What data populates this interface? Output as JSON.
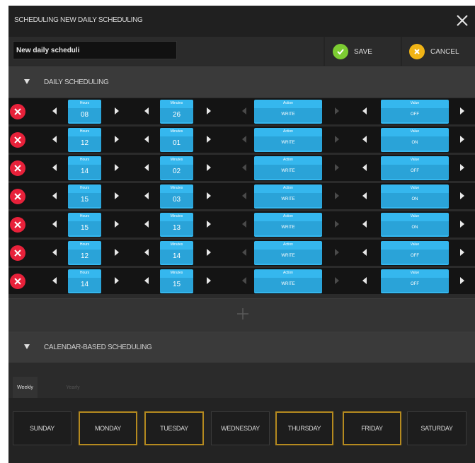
{
  "window": {
    "title": "SCHEDULING NEW DAILY SCHEDULING"
  },
  "toolbar": {
    "name_value": "New daily scheduli",
    "save_label": "SAVE",
    "cancel_label": "CANCEL"
  },
  "daily": {
    "header": "DAILY SCHEDULING"
  },
  "row_captions": {
    "hours": "Hours",
    "minutes": "Minutes",
    "action": "Action",
    "value": "Value"
  },
  "rows": [
    {
      "hours": "08",
      "minutes": "26",
      "action": "WRITE",
      "value": "OFF"
    },
    {
      "hours": "12",
      "minutes": "01",
      "action": "WRITE",
      "value": "ON"
    },
    {
      "hours": "14",
      "minutes": "02",
      "action": "WRITE",
      "value": "OFF"
    },
    {
      "hours": "15",
      "minutes": "03",
      "action": "WRITE",
      "value": "ON"
    },
    {
      "hours": "15",
      "minutes": "13",
      "action": "WRITE",
      "value": "ON"
    },
    {
      "hours": "12",
      "minutes": "14",
      "action": "WRITE",
      "value": "OFF"
    },
    {
      "hours": "14",
      "minutes": "15",
      "action": "WRITE",
      "value": "OFF"
    }
  ],
  "calendar": {
    "header": "CALENDAR-BASED SCHEDULING",
    "tabs": [
      "Weekly",
      "Yearly"
    ],
    "active_tab": "Weekly",
    "days": [
      "SUNDAY",
      "MONDAY",
      "TUESDAY",
      "WEDNESDAY",
      "THURSDAY",
      "FRIDAY",
      "SATURDAY"
    ],
    "selected_days": [
      "MONDAY",
      "TUESDAY",
      "THURSDAY",
      "FRIDAY"
    ]
  },
  "colors": {
    "accent_blue": "#35b7ee",
    "delete_red": "#e8213a",
    "save_green": "#7ccc32",
    "cancel_yellow": "#f0b416",
    "selected_day_border": "#b58a1f"
  },
  "icons": {
    "close": "close-icon",
    "save": "check-circle-icon",
    "cancel": "x-circle-icon",
    "delete": "delete-circle-icon",
    "collapse": "triangle-down-icon",
    "add": "plus-icon",
    "prev": "arrow-left-icon",
    "next": "arrow-right-icon"
  }
}
